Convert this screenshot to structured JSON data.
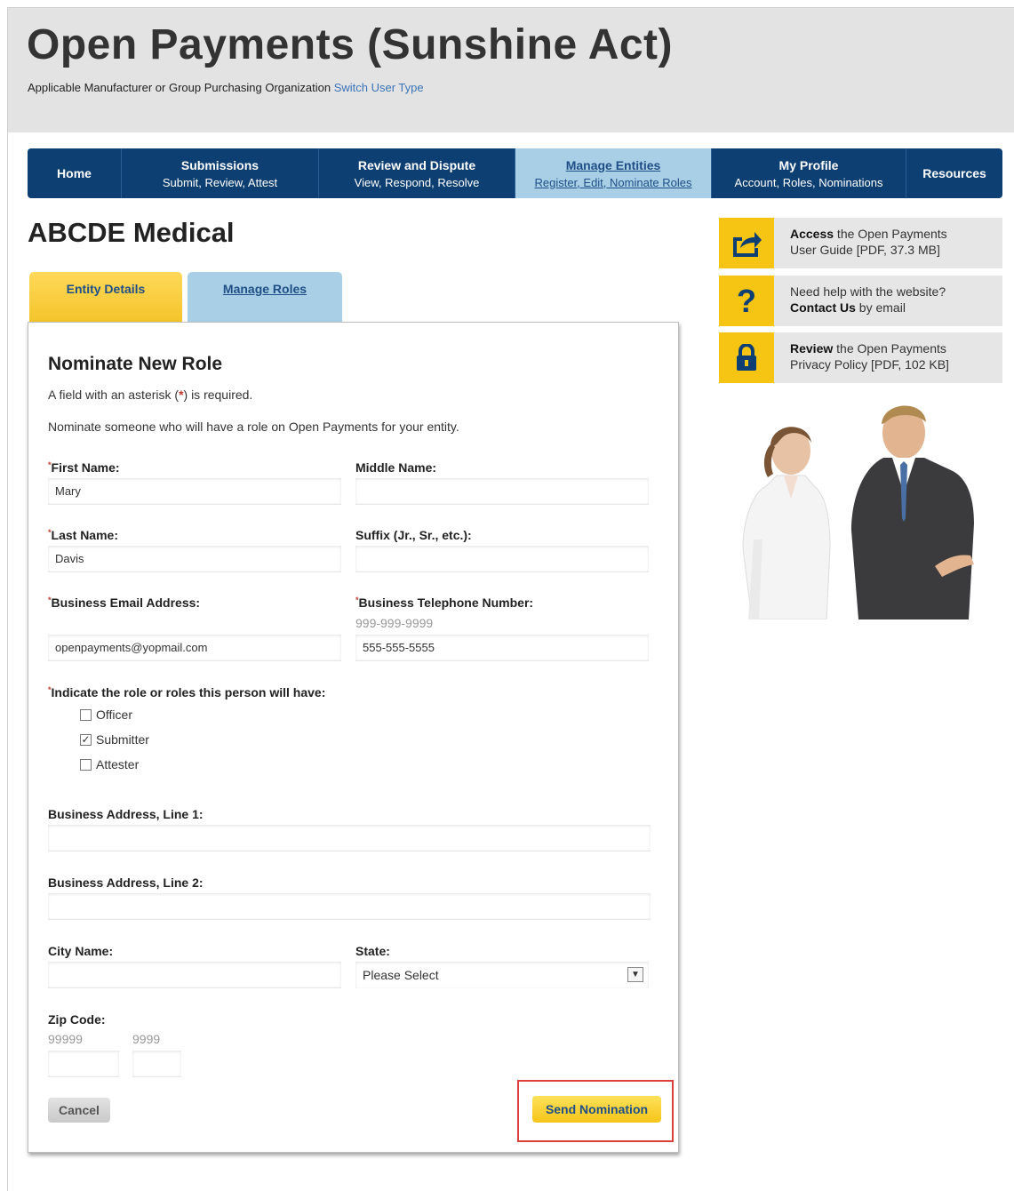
{
  "header": {
    "title": "Open Payments (Sunshine Act)",
    "user_type_text": "Applicable Manufacturer or Group Purchasing Organization",
    "switch_link": "Switch User Type"
  },
  "nav": {
    "home": "Home",
    "submissions_title": "Submissions",
    "submissions_sub": "Submit, Review, Attest",
    "review_title": "Review and Dispute",
    "review_sub": "View, Respond, Resolve",
    "manage_title": "Manage Entities",
    "manage_sub": "Register, Edit, Nominate Roles",
    "profile_title": "My Profile",
    "profile_sub": "Account, Roles, Nominations",
    "resources": "Resources"
  },
  "entity": {
    "name": "ABCDE Medical"
  },
  "tabs": {
    "entity_details": "Entity Details",
    "manage_roles": "Manage Roles"
  },
  "form": {
    "title": "Nominate New Role",
    "required_note_pre": "A field with an asterisk (",
    "required_note_ast": "*",
    "required_note_post": ") is required.",
    "intro": "Nominate someone who will have a role on Open Payments for your entity.",
    "first_name_label": "First Name:",
    "first_name_value": "Mary",
    "middle_name_label": "Middle Name:",
    "middle_name_value": "",
    "last_name_label": "Last Name:",
    "last_name_value": "Davis",
    "suffix_label": "Suffix (Jr., Sr., etc.):",
    "suffix_value": "",
    "email_label": "Business Email Address:",
    "email_value": "openpayments@yopmail.com",
    "phone_label": "Business Telephone Number:",
    "phone_hint": "999-999-9999",
    "phone_value": "555-555-5555",
    "roles_label": "Indicate the role or roles this person will have:",
    "roles": [
      {
        "label": "Officer",
        "checked": false
      },
      {
        "label": "Submitter",
        "checked": true
      },
      {
        "label": "Attester",
        "checked": false
      }
    ],
    "address1_label": "Business Address, Line 1:",
    "address2_label": "Business Address, Line 2:",
    "city_label": "City Name:",
    "state_label": "State:",
    "state_value": "Please Select",
    "zip_label": "Zip Code:",
    "zip_hint1": "99999",
    "zip_hint2": "9999",
    "cancel": "Cancel",
    "send": "Send Nomination"
  },
  "sidebar": {
    "guide_bold": "Access",
    "guide_text1": " the Open Payments",
    "guide_text2": "User Guide [PDF, 37.3 MB]",
    "help_text1": "Need help with the website?",
    "help_bold": "Contact Us",
    "help_text2": " by email",
    "privacy_bold": "Review",
    "privacy_text1": " the Open Payments",
    "privacy_text2": "Privacy Policy [PDF, 102 KB]"
  },
  "colors": {
    "nav": "#0d3f73",
    "accent_yellow": "#f6c413",
    "active_tab": "#a9cfe6",
    "link": "#3a74b8",
    "highlight": "#d9413a"
  }
}
